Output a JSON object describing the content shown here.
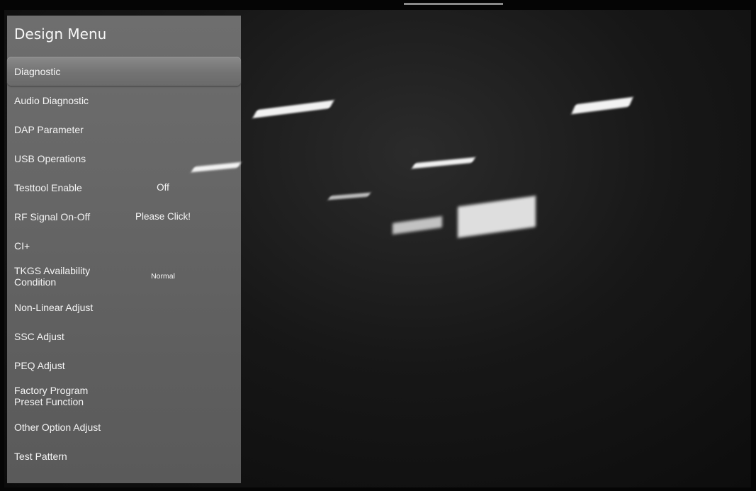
{
  "design_menu": {
    "title": "Design Menu",
    "items": [
      {
        "label": "Diagnostic",
        "value": ""
      },
      {
        "label": "Audio Diagnostic",
        "value": ""
      },
      {
        "label": "DAP Parameter",
        "value": ""
      },
      {
        "label": "USB Operations",
        "value": ""
      },
      {
        "label": "Testtool Enable",
        "value": "Off"
      },
      {
        "label": "RF Signal On-Off",
        "value": "Please Click!"
      },
      {
        "label": "CI+",
        "value": ""
      },
      {
        "label": "TKGS Availability\nCondition",
        "value": "Normal"
      },
      {
        "label": "Non-Linear Adjust",
        "value": ""
      },
      {
        "label": "SSC Adjust",
        "value": ""
      },
      {
        "label": "PEQ Adjust",
        "value": ""
      },
      {
        "label": "Factory Program\nPreset Function",
        "value": ""
      },
      {
        "label": "Other Option Adjust",
        "value": ""
      },
      {
        "label": "Test Pattern",
        "value": ""
      }
    ],
    "selected_index": 0
  }
}
